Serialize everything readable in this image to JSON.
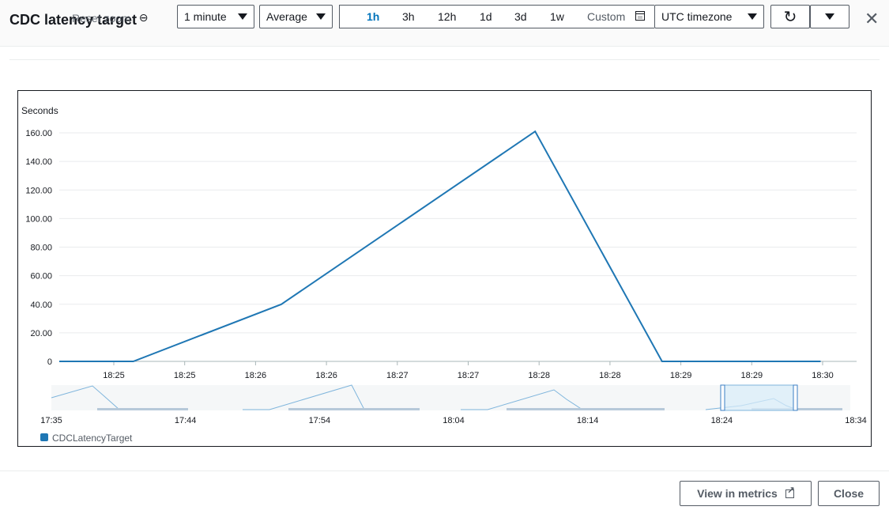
{
  "header": {
    "title": "CDC latency target",
    "reset_zoom": "Reset zoom",
    "period_select": "1 minute",
    "stat_select": "Average",
    "ranges": [
      "1h",
      "3h",
      "12h",
      "1d",
      "3d",
      "1w"
    ],
    "active_range": "1h",
    "custom_label": "Custom",
    "timezone_select": "UTC timezone"
  },
  "footer": {
    "view_in_metrics": "View in metrics",
    "close": "Close"
  },
  "colors": {
    "series": "#1f77b4",
    "active_range": "#0073bb"
  },
  "chart_data": {
    "type": "line",
    "ylabel": "Seconds",
    "ylim": [
      0,
      160
    ],
    "yticks": [
      "160.00",
      "140.00",
      "120.00",
      "100.00",
      "80.00",
      "60.00",
      "40.00",
      "20.00",
      "0"
    ],
    "xticks": [
      "18:25",
      "18:25",
      "18:26",
      "18:26",
      "18:27",
      "18:27",
      "18:28",
      "18:28",
      "18:29",
      "18:29",
      "18:30"
    ],
    "grid": true,
    "legend_position": "bottom-left",
    "series": [
      {
        "name": "CDCLatencyTarget",
        "color": "#1f77b4",
        "x": [
          "18:24:15",
          "18:24:50",
          "18:26:00",
          "18:28:00",
          "18:29:00",
          "18:30:15"
        ],
        "values": [
          0,
          0,
          40,
          161,
          0,
          0
        ]
      }
    ],
    "overview": {
      "xticks": [
        "17:35",
        "17:44",
        "17:54",
        "18:04",
        "18:14",
        "18:24",
        "18:34"
      ]
    }
  }
}
